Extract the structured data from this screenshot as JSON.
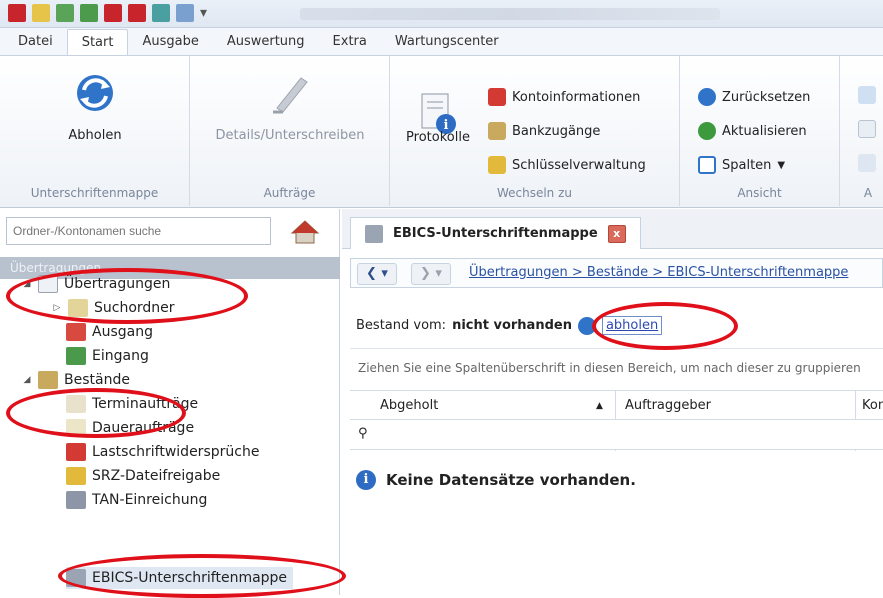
{
  "menu": {
    "tabs": [
      {
        "label": "Datei"
      },
      {
        "label": "Start"
      },
      {
        "label": "Ausgabe"
      },
      {
        "label": "Auswertung"
      },
      {
        "label": "Extra"
      },
      {
        "label": "Wartungscenter"
      }
    ]
  },
  "ribbon": {
    "abholen": "Abholen",
    "details": "Details/Unterschreiben",
    "protokolle": "Protokolle",
    "kontoinformationen": "Kontoinformationen",
    "bankzugaenge": "Bankzugänge",
    "schluesselverwaltung": "Schlüsselverwaltung",
    "zuruecksetzen": "Zurücksetzen",
    "aktualisieren": "Aktualisieren",
    "spalten": "Spalten",
    "groups": {
      "unterschriftenmappe": "Unterschriftenmappe",
      "auftraege": "Aufträge",
      "wechseln": "Wechseln zu",
      "ansicht": "Ansicht",
      "cut": "A"
    }
  },
  "nav": {
    "search_placeholder": "Ordner-/Kontonamen suche",
    "header": "Übertragungen",
    "items": {
      "uebertragungen": "Übertragungen",
      "suchordner": "Suchordner",
      "ausgang": "Ausgang",
      "eingang": "Eingang",
      "bestaende": "Bestände",
      "terminauftraege": "Terminaufträge",
      "dauerauftraege": "Daueraufträge",
      "lastschrift": "Lastschriftwidersprüche",
      "srz": "SRZ-Dateifreigabe",
      "tan": "TAN-Einreichung",
      "ebics": "EBICS-Unterschriftenmappe"
    }
  },
  "doc": {
    "tab_title": "EBICS-Unterschriftenmappe",
    "close": "x",
    "breadcrumb": "Übertragungen > Bestände > EBICS-Unterschriftenmappe",
    "status_label": "Bestand vom:",
    "status_value": "nicht vorhanden",
    "fetch_link": "abholen",
    "group_hint": "Ziehen Sie eine Spaltenüberschrift in diesen Bereich, um nach dieser zu gruppieren",
    "columns": [
      "Abgeholt",
      "Auftraggeber",
      "Kon"
    ],
    "empty_message": "Keine Datensätze vorhanden."
  },
  "colors": {
    "accent": "#2952a3",
    "annotation": "#e0101a"
  }
}
